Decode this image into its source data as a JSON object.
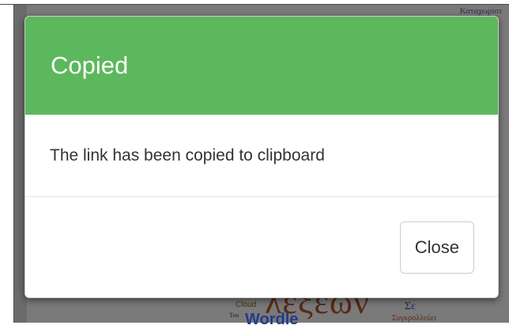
{
  "modal": {
    "title": "Copied",
    "message": "The link has been copied to clipboard",
    "close_label": "Close",
    "header_color": "#5cb85c"
  },
  "background": {
    "word_cloud": {
      "top_word": "Καταχωρίσε",
      "big_word": "λέξεων",
      "cloud": "Cloud",
      "sigma": "Σε",
      "wordle": "Wordle",
      "tou": "Του",
      "small_word": "Συγκρολλεύει"
    }
  }
}
